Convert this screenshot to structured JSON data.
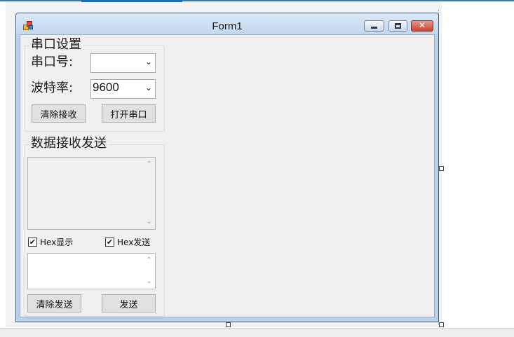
{
  "form": {
    "title": "Form1"
  },
  "serial_settings": {
    "group_title": "串口设置",
    "port_label": "串口号:",
    "port_value": "",
    "baud_label": "波特率:",
    "baud_value": "9600",
    "clear_receive_label": "清除接收",
    "open_port_label": "打开串口"
  },
  "data_section": {
    "group_title": "数据接收发送",
    "hex_display_label": "Hex显示",
    "hex_display_checked": true,
    "hex_send_label": "Hex发送",
    "hex_send_checked": true,
    "receive_text": "",
    "send_text": "",
    "clear_send_label": "清除发送",
    "send_label": "发送"
  },
  "icons": {
    "check": "✔",
    "dropdown": "⌄",
    "scroll_up": "⌃",
    "scroll_down": "⌄",
    "close": "✕"
  },
  "colors": {
    "accent_strip": "#2e7fbf",
    "close_button": "#c7452f",
    "client_background": "#f0f0f0"
  }
}
